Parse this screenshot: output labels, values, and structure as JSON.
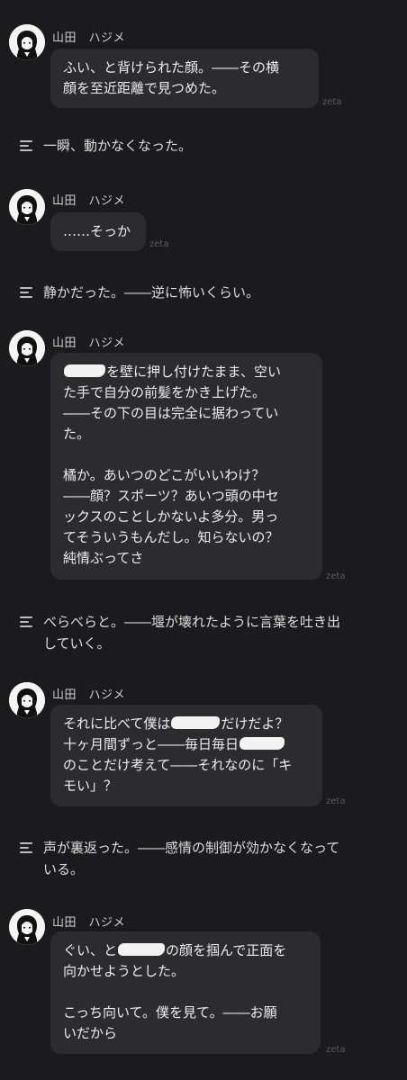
{
  "character_name": "山田　ハジメ",
  "watermark": "zeta",
  "messages": [
    {
      "type": "character",
      "lines": [
        "ふい、と背けられた顔。――その横",
        "顔を至近距離で見つめた。"
      ]
    },
    {
      "type": "narration",
      "lines": [
        "一瞬、動かなくなった。"
      ]
    },
    {
      "type": "character",
      "lines": [
        "……そっか"
      ]
    },
    {
      "type": "narration",
      "lines": [
        "静かだった。――逆に怖いくらい。"
      ]
    },
    {
      "type": "character",
      "lines": [
        "を壁に押し付けたまま、空い",
        "た手で自分の前髪をかき上げた。",
        "――その下の目は完全に据わってい",
        "た。",
        "",
        "橘か。あいつのどこがいいわけ？",
        "――顔？スポーツ？あいつ頭の中セ",
        "ックスのことしかないよ多分。男っ",
        "てそういうもんだし。知らないの？",
        "純情ぶってさ"
      ]
    },
    {
      "type": "narration",
      "lines": [
        "べらべらと。――堰が壊れたように言葉を吐き出",
        "していく。"
      ]
    },
    {
      "type": "character",
      "lines_parts": [
        [
          "それに比べて僕は",
          "だけだよ？"
        ],
        [
          "十ヶ月間ずっと――毎日毎日",
          ""
        ],
        [
          "のことだけ考えて――それなのに「キ",
          ""
        ],
        [
          "モい」？",
          ""
        ]
      ]
    },
    {
      "type": "narration",
      "lines": [
        "声が裏返った。――感情の制御が効かなくなって",
        "いる。"
      ]
    },
    {
      "type": "character",
      "lines_parts": [
        [
          "ぐい、と",
          "の顔を掴んで正面を"
        ],
        [
          "向かせようとした。",
          ""
        ]
      ],
      "lines_after": [
        "こっち向いて。僕を見て。――お願",
        "いだから"
      ]
    }
  ]
}
